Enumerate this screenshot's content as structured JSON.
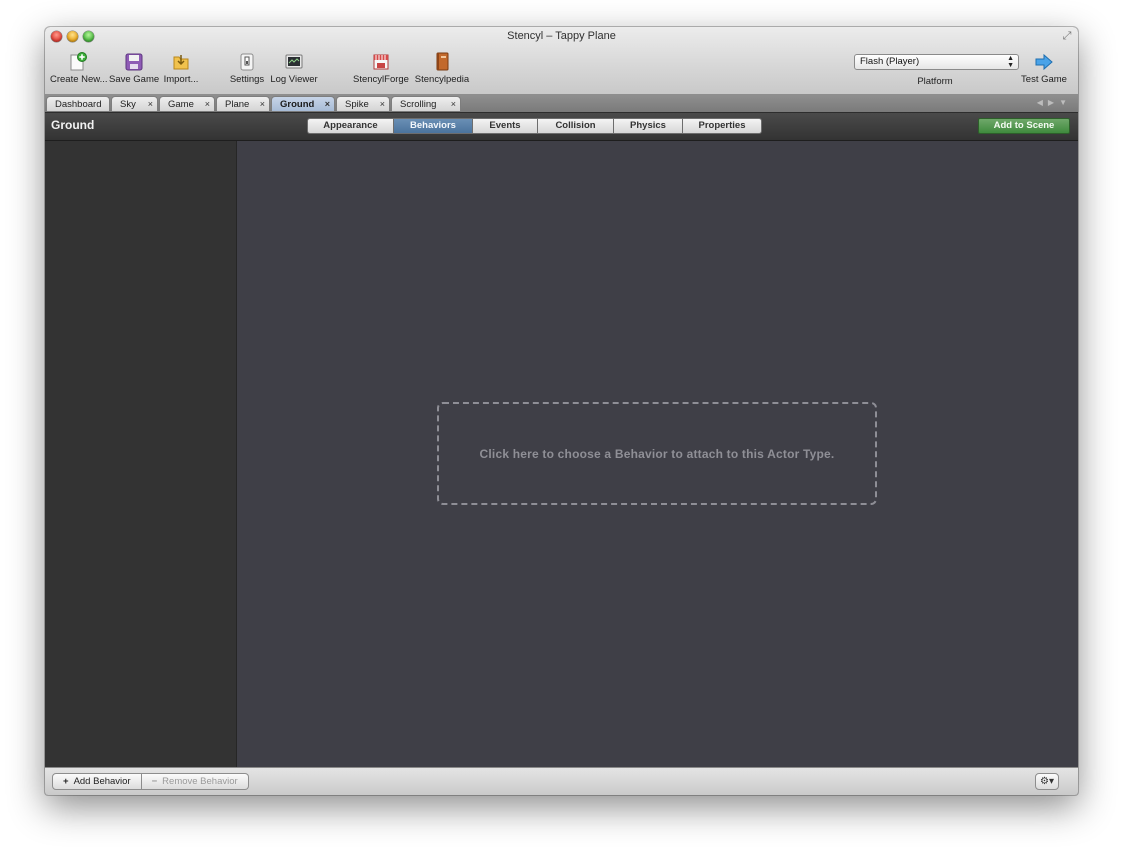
{
  "window": {
    "title": "Stencyl – Tappy Plane"
  },
  "toolbar": {
    "items": [
      {
        "label": "Create New...",
        "icon": "create-new-icon"
      },
      {
        "label": "Save Game",
        "icon": "save-icon"
      },
      {
        "label": "Import...",
        "icon": "import-icon"
      },
      {
        "label": "Settings",
        "icon": "settings-icon"
      },
      {
        "label": "Log Viewer",
        "icon": "log-viewer-icon"
      },
      {
        "label": "StencylForge",
        "icon": "stencylforge-icon"
      },
      {
        "label": "Stencylpedia",
        "icon": "stencylpedia-icon"
      }
    ],
    "platform": {
      "selected": "Flash (Player)",
      "label": "Platform"
    },
    "test_game": {
      "label": "Test Game",
      "icon": "arrow-right-icon"
    }
  },
  "tabs": [
    {
      "label": "Dashboard",
      "closable": false
    },
    {
      "label": "Sky",
      "closable": true
    },
    {
      "label": "Game",
      "closable": true
    },
    {
      "label": "Plane",
      "closable": true
    },
    {
      "label": "Ground",
      "closable": true,
      "active": true
    },
    {
      "label": "Spike",
      "closable": true
    },
    {
      "label": "Scrolling",
      "closable": true
    }
  ],
  "close_glyph": "×",
  "section": {
    "title": "Ground",
    "segments": [
      "Appearance",
      "Behaviors",
      "Events",
      "Collision",
      "Physics",
      "Properties"
    ],
    "active_segment": "Behaviors",
    "add_to_scene": "Add to Scene"
  },
  "main": {
    "empty_hint": "Click here to choose a Behavior to attach to this Actor Type."
  },
  "bottom": {
    "add_behavior": "Add Behavior",
    "add_symbol": "+",
    "remove_behavior": "Remove Behavior",
    "remove_symbol": "−",
    "gear_icon": "gear-icon"
  },
  "colors": {
    "accent_active_tab": "#a7bbd6",
    "segment_active": "#4b739c",
    "add_to_scene": "#3f8a3d",
    "workspace": "#3f3f47",
    "sidebar": "#333333"
  }
}
